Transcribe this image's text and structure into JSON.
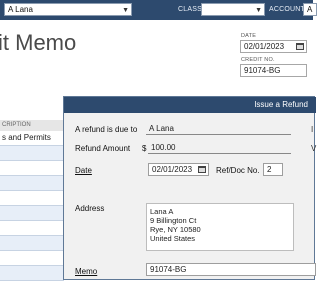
{
  "topbar": {
    "customer_value": "A Lana",
    "class_label": "CLASS",
    "class_value": "",
    "account_label": "ACCOUNT",
    "account_value": "A"
  },
  "form": {
    "title_fragment": "it Memo",
    "date_label": "DATE",
    "date_value": "02/01/2023",
    "credit_no_label": "CREDIT NO.",
    "credit_no_value": "91074-BG",
    "table_header": "CRIPTION",
    "rows": [
      "s and Permits",
      "",
      "",
      "",
      "",
      "",
      "",
      "",
      "",
      ""
    ]
  },
  "dialog": {
    "title": "Issue a Refund",
    "refund_due_label": "A refund is due to",
    "refund_due_value": "A Lana",
    "refund_amount_label": "Refund Amount",
    "currency_symbol": "$",
    "refund_amount_value": "100.00",
    "date_label": "Date",
    "date_value": "02/01/2023",
    "ref_label": "Ref/Doc No.",
    "ref_value": "2",
    "address_label": "Address",
    "address_lines": [
      "Lana A",
      "9 Billington Ct",
      "Rye, NY 10580",
      "United States"
    ],
    "memo_label": "Memo",
    "memo_value": "91074-BG",
    "edge_char_1": "I",
    "edge_char_2": "V"
  },
  "icons": {
    "dropdown": "chevron-down-icon",
    "calendar": "calendar-icon"
  },
  "colors": {
    "header_bg": "#2d4a6e",
    "row_alt": "#e7eef8"
  }
}
